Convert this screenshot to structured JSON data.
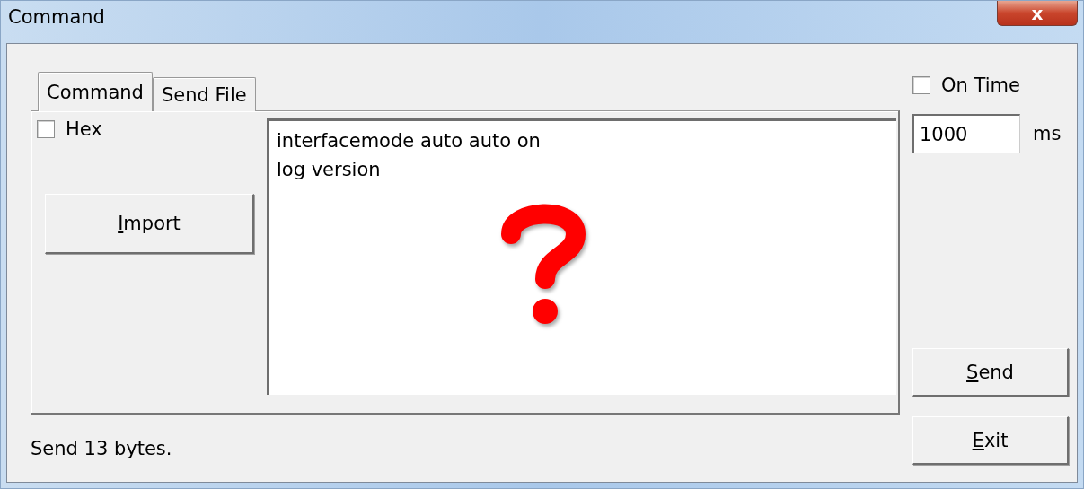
{
  "window": {
    "title": "Command",
    "close_label": "x"
  },
  "tabs": [
    {
      "label": "Command",
      "selected": true
    },
    {
      "label": "Send File",
      "selected": false
    }
  ],
  "hex": {
    "label": "Hex",
    "checked": false
  },
  "import_button": {
    "label": "Import",
    "mnemonic_underline": true
  },
  "command_text": {
    "lines": [
      "interfacemode auto auto on",
      "log version"
    ]
  },
  "overlay": {
    "question_mark": true
  },
  "on_time": {
    "label": "On Time",
    "checked": false
  },
  "interval": {
    "value": "1000",
    "unit": "ms"
  },
  "buttons": [
    {
      "label": "Send",
      "mnemonic_underline": true
    },
    {
      "label": "Exit",
      "mnemonic_underline": true
    }
  ],
  "status": "Send 13 bytes."
}
